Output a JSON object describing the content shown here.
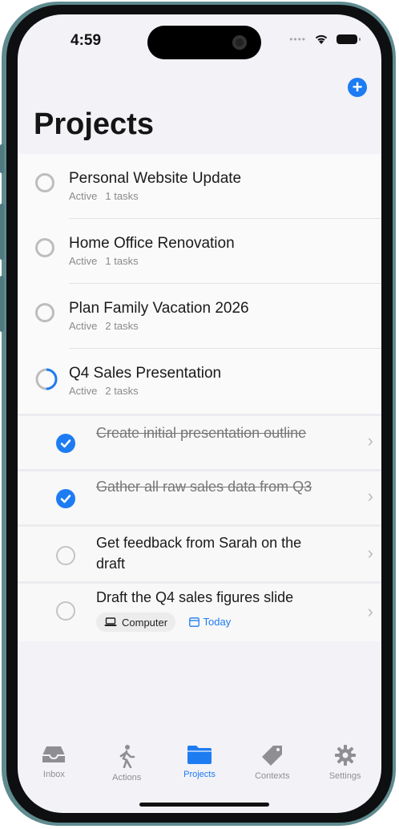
{
  "status": {
    "time": "4:59"
  },
  "header": {
    "title": "Projects"
  },
  "projects": [
    {
      "name": "Personal Website Update",
      "status": "Active",
      "tasks": "1 tasks"
    },
    {
      "name": "Home Office Renovation",
      "status": "Active",
      "tasks": "1 tasks"
    },
    {
      "name": "Plan Family Vacation 2026",
      "status": "Active",
      "tasks": "2 tasks"
    },
    {
      "name": "Q4 Sales Presentation",
      "status": "Active",
      "tasks": "2 tasks",
      "progress": 0.5
    }
  ],
  "tasks": [
    {
      "label": "Create initial presentation outline",
      "done": true
    },
    {
      "label": "Gather all raw sales data from Q3",
      "done": true
    },
    {
      "label": "Get feedback from Sarah on the draft",
      "done": false
    },
    {
      "label": "Draft the Q4 sales figures slide",
      "done": false,
      "context": "Computer",
      "due": "Today"
    }
  ],
  "tabs": [
    {
      "label": "Inbox",
      "icon": "inbox-icon",
      "active": false
    },
    {
      "label": "Actions",
      "icon": "walking-person-icon",
      "active": false
    },
    {
      "label": "Projects",
      "icon": "folder-icon",
      "active": true
    },
    {
      "label": "Contexts",
      "icon": "tag-icon",
      "active": false
    },
    {
      "label": "Settings",
      "icon": "gear-icon",
      "active": false
    }
  ],
  "colors": {
    "accent": "#1e7cf2",
    "inactive": "#8e8e93",
    "frame": "#5f8b8f"
  }
}
